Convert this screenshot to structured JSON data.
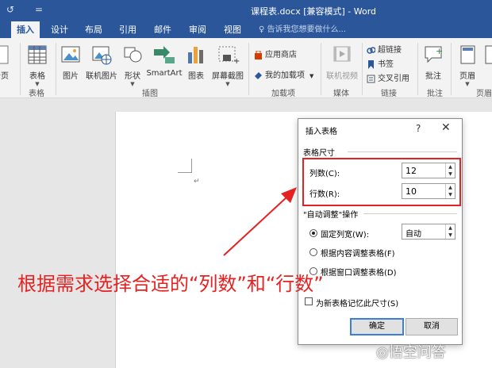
{
  "window": {
    "title": "课程表.docx [兼容模式] - Word",
    "quick_access": {
      "redo_glyph": "↺",
      "more_glyph": "="
    }
  },
  "tabs": [
    {
      "label": "插入",
      "active": true
    },
    {
      "label": "设计"
    },
    {
      "label": "布局"
    },
    {
      "label": "引用"
    },
    {
      "label": "邮件"
    },
    {
      "label": "审阅"
    },
    {
      "label": "视图"
    }
  ],
  "tell_me": "♀ 告诉我您想要做什么...",
  "ribbon": {
    "partial_left": "分页",
    "table_btn": "表格",
    "picture_btn": "图片",
    "online_picture_btn": "联机图片",
    "shapes_btn": "形状",
    "smartart_btn": "SmartArt",
    "chart_btn": "图表",
    "screenshot_btn": "屏幕截图",
    "store_btn": "应用商店",
    "my_addins_btn": "我的加载项",
    "online_video_btn": "联机视频",
    "hyperlink_btn": "超链接",
    "bookmark_btn": "书签",
    "crossref_btn": "交叉引用",
    "comment_btn": "批注",
    "header_btn": "页眉",
    "partial_right": "页",
    "groups": {
      "tables": "表格",
      "illustrations": "插图",
      "addins": "加载项",
      "media": "媒体",
      "links": "链接",
      "comments": "批注",
      "header_footer": "页眉"
    },
    "colors": {
      "accent": "#2b579a",
      "store_icon": "#d83b01",
      "addins_icon": "#2b579a"
    }
  },
  "document": {
    "para_mark": "↵"
  },
  "dialog": {
    "title": "插入表格",
    "help": "?",
    "close": "✕",
    "size_section": "表格尺寸",
    "columns_label": "列数(C):",
    "columns_value": "12",
    "rows_label": "行数(R):",
    "rows_value": "10",
    "autofit_section": "\"自动调整\"操作",
    "fixed_width_label": "固定列宽(W):",
    "fixed_width_value": "自动",
    "autofit_contents_label": "根据内容调整表格(F)",
    "autofit_window_label": "根据窗口调整表格(D)",
    "remember_label": "为新表格记忆此尺寸(S)",
    "ok": "确定",
    "cancel": "取消"
  },
  "annotation": {
    "text": "根据需求选择合适的“列数”和“行数”",
    "color": "#e52222"
  },
  "watermark": "悟空问答"
}
